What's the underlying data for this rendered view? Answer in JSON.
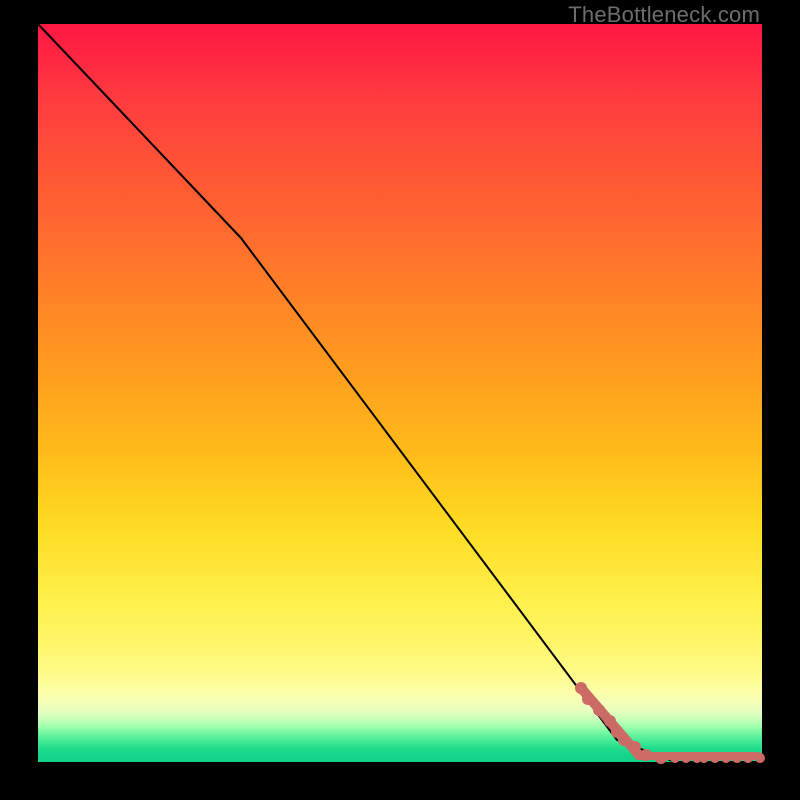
{
  "watermark": "TheBottleneck.com",
  "colors": {
    "frame": "#000000",
    "gradient_top": "#ff1744",
    "gradient_mid": "#ffdb22",
    "gradient_bottom": "#10d288",
    "curve": "#000000",
    "marker": "#cc6b66"
  },
  "chart_data": {
    "type": "line",
    "title": "",
    "xlabel": "",
    "ylabel": "",
    "xlim": [
      0,
      100
    ],
    "ylim": [
      0,
      100
    ],
    "series": [
      {
        "name": "bottleneck-curve",
        "x": [
          0,
          28,
          80,
          88,
          100
        ],
        "y": [
          100,
          71,
          3,
          0,
          0
        ]
      }
    ],
    "markers": {
      "name": "highlighted-points",
      "x": [
        75,
        76,
        77.5,
        79,
        80,
        81,
        82.5,
        84,
        86,
        88,
        89.5,
        91,
        92,
        93.5,
        95,
        96.5,
        98,
        100
      ],
      "y": [
        10,
        8.5,
        7,
        5.5,
        4,
        3,
        2,
        1,
        0.5,
        0,
        0,
        0,
        0,
        0,
        0,
        0,
        0,
        0
      ]
    },
    "annotations": []
  }
}
